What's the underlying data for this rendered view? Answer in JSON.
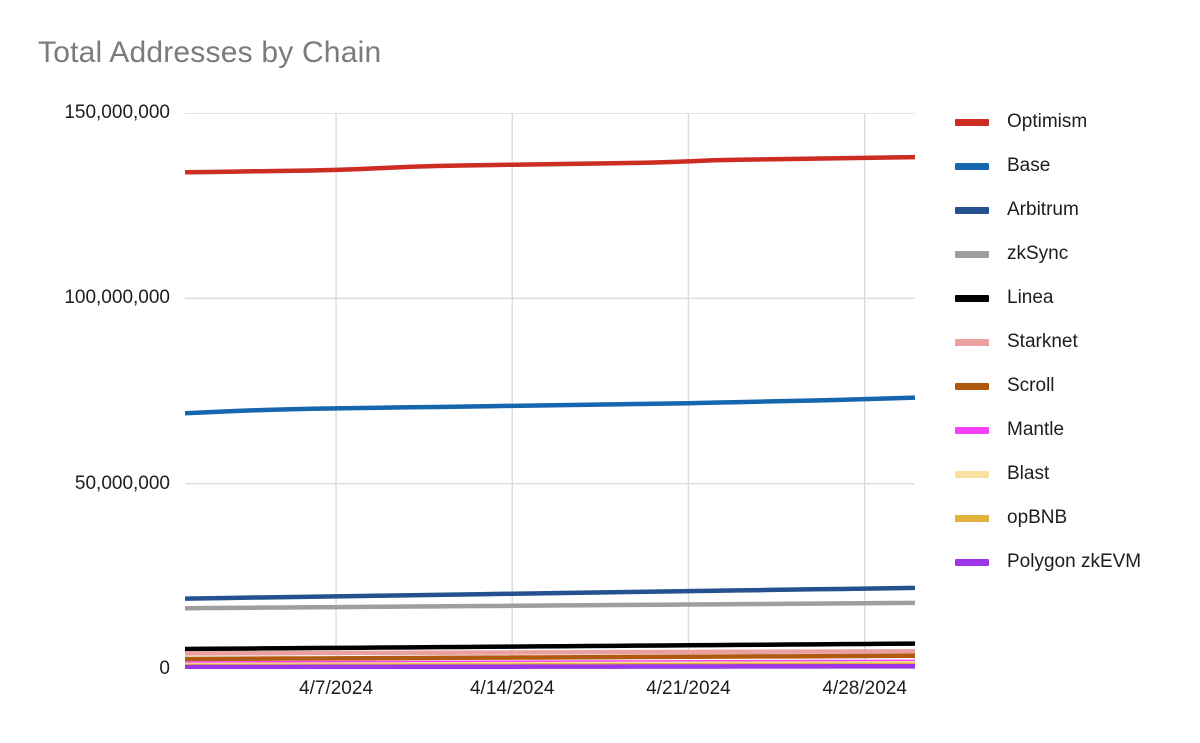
{
  "chart_data": {
    "type": "line",
    "title": "Total Addresses by Chain",
    "xlabel": "",
    "ylabel": "",
    "grid": true,
    "legend_position": "right",
    "ylim": [
      0,
      150000000
    ],
    "y_ticks": [
      0,
      50000000,
      100000000,
      150000000
    ],
    "y_tick_labels": [
      "0",
      "50,000,000",
      "100,000,000",
      "150,000,000"
    ],
    "x": [
      "4/1/2024",
      "4/2/2024",
      "4/3/2024",
      "4/4/2024",
      "4/5/2024",
      "4/6/2024",
      "4/7/2024",
      "4/8/2024",
      "4/9/2024",
      "4/10/2024",
      "4/11/2024",
      "4/12/2024",
      "4/13/2024",
      "4/14/2024",
      "4/15/2024",
      "4/16/2024",
      "4/17/2024",
      "4/18/2024",
      "4/19/2024",
      "4/20/2024",
      "4/21/2024",
      "4/22/2024",
      "4/23/2024",
      "4/24/2024",
      "4/25/2024",
      "4/26/2024",
      "4/27/2024",
      "4/28/2024",
      "4/29/2024",
      "4/30/2024"
    ],
    "x_tick_labels": [
      "4/7/2024",
      "4/14/2024",
      "4/21/2024",
      "4/28/2024"
    ],
    "x_tick_indices": [
      6,
      13,
      20,
      27
    ],
    "series": [
      {
        "name": "Optimism",
        "color": "#cc2c22",
        "values": [
          134000000,
          134100000,
          134200000,
          134300000,
          134400000,
          134500000,
          134650000,
          134900000,
          135200000,
          135500000,
          135700000,
          135850000,
          135950000,
          136050000,
          136150000,
          136250000,
          136350000,
          136450000,
          136550000,
          136700000,
          136950000,
          137250000,
          137400000,
          137500000,
          137600000,
          137700000,
          137800000,
          137900000,
          138000000,
          138100000
        ]
      },
      {
        "name": "Base",
        "color": "#1566ad",
        "values": [
          69000000,
          69300000,
          69600000,
          69850000,
          70050000,
          70200000,
          70300000,
          70400000,
          70500000,
          70600000,
          70700000,
          70800000,
          70900000,
          71000000,
          71100000,
          71200000,
          71300000,
          71400000,
          71500000,
          71600000,
          71700000,
          71850000,
          72000000,
          72150000,
          72300000,
          72450000,
          72600000,
          72800000,
          73000000,
          73200000
        ]
      },
      {
        "name": "Arbitrum",
        "color": "#24518f",
        "values": [
          19000000,
          19100000,
          19200000,
          19300000,
          19400000,
          19500000,
          19600000,
          19700000,
          19800000,
          19900000,
          20000000,
          20100000,
          20200000,
          20300000,
          20400000,
          20500000,
          20600000,
          20700000,
          20800000,
          20900000,
          21000000,
          21100000,
          21200000,
          21300000,
          21400000,
          21500000,
          21600000,
          21700000,
          21800000,
          21900000
        ]
      },
      {
        "name": "zkSync",
        "color": "#9e9e9e",
        "values": [
          16400000,
          16450000,
          16500000,
          16550000,
          16600000,
          16650000,
          16700000,
          16750000,
          16800000,
          16850000,
          16900000,
          16950000,
          17000000,
          17050000,
          17100000,
          17150000,
          17200000,
          17250000,
          17300000,
          17350000,
          17400000,
          17450000,
          17500000,
          17550000,
          17600000,
          17650000,
          17700000,
          17750000,
          17800000,
          17850000
        ]
      },
      {
        "name": "Linea",
        "color": "#000000",
        "values": [
          5400000,
          5450000,
          5500000,
          5550000,
          5600000,
          5650000,
          5700000,
          5750000,
          5800000,
          5850000,
          5900000,
          5950000,
          6000000,
          6050000,
          6100000,
          6150000,
          6200000,
          6250000,
          6300000,
          6350000,
          6400000,
          6450000,
          6500000,
          6550000,
          6600000,
          6650000,
          6700000,
          6750000,
          6800000,
          6850000
        ]
      },
      {
        "name": "Starknet",
        "color": "#eba0a0",
        "values": [
          4200000,
          4220000,
          4240000,
          4260000,
          4280000,
          4300000,
          4320000,
          4340000,
          4360000,
          4380000,
          4400000,
          4420000,
          4440000,
          4460000,
          4480000,
          4500000,
          4520000,
          4540000,
          4560000,
          4580000,
          4600000,
          4620000,
          4640000,
          4660000,
          4680000,
          4700000,
          4720000,
          4740000,
          4760000,
          4780000
        ]
      },
      {
        "name": "Scroll",
        "color": "#b05a10",
        "values": [
          2700000,
          2730000,
          2760000,
          2790000,
          2820000,
          2850000,
          2880000,
          2910000,
          2940000,
          2970000,
          3000000,
          3030000,
          3060000,
          3090000,
          3120000,
          3150000,
          3180000,
          3210000,
          3240000,
          3270000,
          3300000,
          3330000,
          3360000,
          3390000,
          3420000,
          3450000,
          3480000,
          3510000,
          3540000,
          3570000
        ]
      },
      {
        "name": "Mantle",
        "color": "#f83ff8",
        "values": [
          1500000,
          1515000,
          1530000,
          1545000,
          1560000,
          1575000,
          1590000,
          1605000,
          1620000,
          1635000,
          1650000,
          1665000,
          1680000,
          1695000,
          1710000,
          1725000,
          1740000,
          1755000,
          1770000,
          1785000,
          1800000,
          1815000,
          1830000,
          1845000,
          1860000,
          1875000,
          1890000,
          1905000,
          1920000,
          1935000
        ]
      },
      {
        "name": "Blast",
        "color": "#fae0a0",
        "values": [
          1100000,
          1115000,
          1130000,
          1145000,
          1160000,
          1175000,
          1190000,
          1205000,
          1220000,
          1235000,
          1250000,
          1265000,
          1280000,
          1295000,
          1310000,
          1325000,
          1340000,
          1355000,
          1370000,
          1385000,
          1400000,
          1415000,
          1430000,
          1445000,
          1460000,
          1475000,
          1490000,
          1505000,
          1520000,
          1535000
        ]
      },
      {
        "name": "opBNB",
        "color": "#e3b23c",
        "values": [
          800000,
          812000,
          824000,
          836000,
          848000,
          860000,
          872000,
          884000,
          896000,
          908000,
          920000,
          932000,
          944000,
          956000,
          968000,
          980000,
          992000,
          1004000,
          1016000,
          1028000,
          1040000,
          1052000,
          1064000,
          1076000,
          1088000,
          1100000,
          1112000,
          1124000,
          1136000,
          1148000
        ]
      },
      {
        "name": "Polygon zkEVM",
        "color": "#9d35e8",
        "values": [
          520000,
          528000,
          536000,
          544000,
          552000,
          560000,
          568000,
          576000,
          584000,
          592000,
          600000,
          608000,
          616000,
          624000,
          632000,
          640000,
          648000,
          656000,
          664000,
          672000,
          680000,
          688000,
          696000,
          704000,
          712000,
          720000,
          728000,
          736000,
          744000,
          752000
        ]
      }
    ]
  },
  "colors": {
    "title": "#7b7b7b",
    "axis_text": "#1d1d1d",
    "gridline": "#dcdcdc",
    "background": "#ffffff"
  }
}
